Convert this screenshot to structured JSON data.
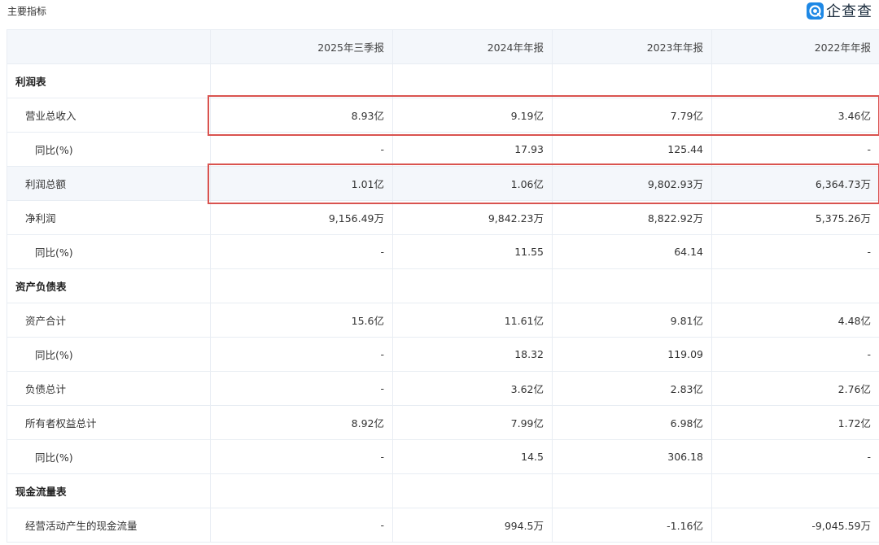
{
  "header": {
    "title": "主要指标",
    "brand_name": "企查查"
  },
  "table": {
    "columns": [
      "",
      "2025年三季报",
      "2024年年报",
      "2023年年报",
      "2022年年报"
    ],
    "rows": [
      {
        "kind": "section",
        "label": "利润表",
        "values": [
          "",
          "",
          "",
          ""
        ]
      },
      {
        "kind": "metric",
        "label": "营业总收入",
        "values": [
          "8.93亿",
          "9.19亿",
          "7.79亿",
          "3.46亿"
        ],
        "highlighted": true
      },
      {
        "kind": "sub",
        "label": "同比(%)",
        "values": [
          "-",
          "17.93",
          "125.44",
          "-"
        ]
      },
      {
        "kind": "metric",
        "label": "利润总额",
        "values": [
          "1.01亿",
          "1.06亿",
          "9,802.93万",
          "6,364.73万"
        ],
        "highlighted": true
      },
      {
        "kind": "metric",
        "label": "净利润",
        "values": [
          "9,156.49万",
          "9,842.23万",
          "8,822.92万",
          "5,375.26万"
        ]
      },
      {
        "kind": "sub",
        "label": "同比(%)",
        "values": [
          "-",
          "11.55",
          "64.14",
          "-"
        ]
      },
      {
        "kind": "section",
        "label": "资产负债表",
        "values": [
          "",
          "",
          "",
          ""
        ]
      },
      {
        "kind": "metric",
        "label": "资产合计",
        "values": [
          "15.6亿",
          "11.61亿",
          "9.81亿",
          "4.48亿"
        ]
      },
      {
        "kind": "sub",
        "label": "同比(%)",
        "values": [
          "-",
          "18.32",
          "119.09",
          "-"
        ]
      },
      {
        "kind": "metric",
        "label": "负债总计",
        "values": [
          "-",
          "3.62亿",
          "2.83亿",
          "2.76亿"
        ]
      },
      {
        "kind": "metric",
        "label": "所有者权益总计",
        "values": [
          "8.92亿",
          "7.99亿",
          "6.98亿",
          "1.72亿"
        ]
      },
      {
        "kind": "sub",
        "label": "同比(%)",
        "values": [
          "-",
          "14.5",
          "306.18",
          "-"
        ]
      },
      {
        "kind": "section",
        "label": "现金流量表",
        "values": [
          "",
          "",
          "",
          ""
        ]
      },
      {
        "kind": "metric",
        "label": "经营活动产生的现金流量",
        "values": [
          "-",
          "994.5万",
          "-1.16亿",
          "-9,045.59万"
        ]
      }
    ]
  },
  "colors": {
    "header_bg": "#f4f7fb",
    "border": "#e8edf3",
    "highlight": "#d9534f",
    "brand_blue": "#1e88e5"
  }
}
